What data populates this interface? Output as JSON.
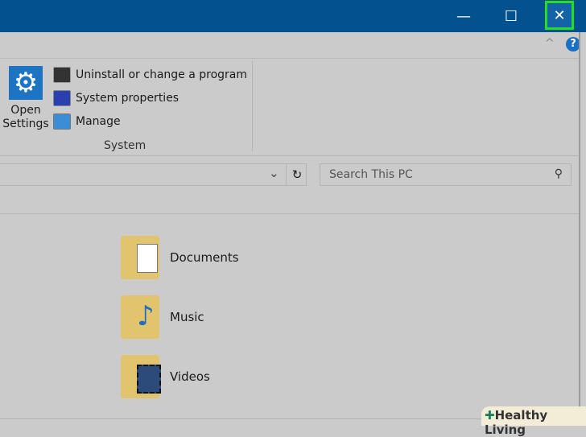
{
  "window": {
    "minimize": "—",
    "maximize": "☐",
    "close": "✕",
    "collapse": "^",
    "help": "?"
  },
  "ribbon": {
    "open_settings": [
      "Open",
      "Settings"
    ],
    "items": [
      "Uninstall or change a program",
      "System properties",
      "Manage"
    ],
    "group": "System"
  },
  "address": {
    "dropdown": "⌄",
    "refresh": "↻"
  },
  "search": {
    "placeholder": "Search This PC"
  },
  "folders": [
    "Documents",
    "Music",
    "Videos"
  ],
  "watermark": "Healthy Living"
}
